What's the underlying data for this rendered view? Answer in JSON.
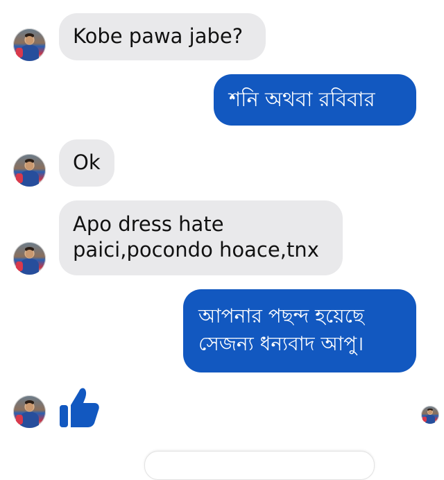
{
  "conversation": {
    "messages": [
      {
        "direction": "incoming",
        "text": "Kobe pawa jabe?"
      },
      {
        "direction": "outgoing",
        "text": "শনি অথবা রবিবার"
      },
      {
        "direction": "incoming",
        "text": "Ok"
      },
      {
        "direction": "incoming",
        "lines": [
          "Apo dress hate",
          "paici,pocondo hoace,tnx"
        ]
      },
      {
        "direction": "outgoing",
        "lines": [
          "আপনার পছন্দ হয়েছে",
          "সেজন্য ধন্যবাদ আপু।"
        ]
      },
      {
        "direction": "incoming",
        "type": "like",
        "icon": "thumbs-up-icon"
      }
    ]
  },
  "colors": {
    "incoming_bubble": "#e9e9eb",
    "outgoing_bubble": "#1258c0",
    "like": "#1258c0",
    "background": "#ffffff"
  }
}
